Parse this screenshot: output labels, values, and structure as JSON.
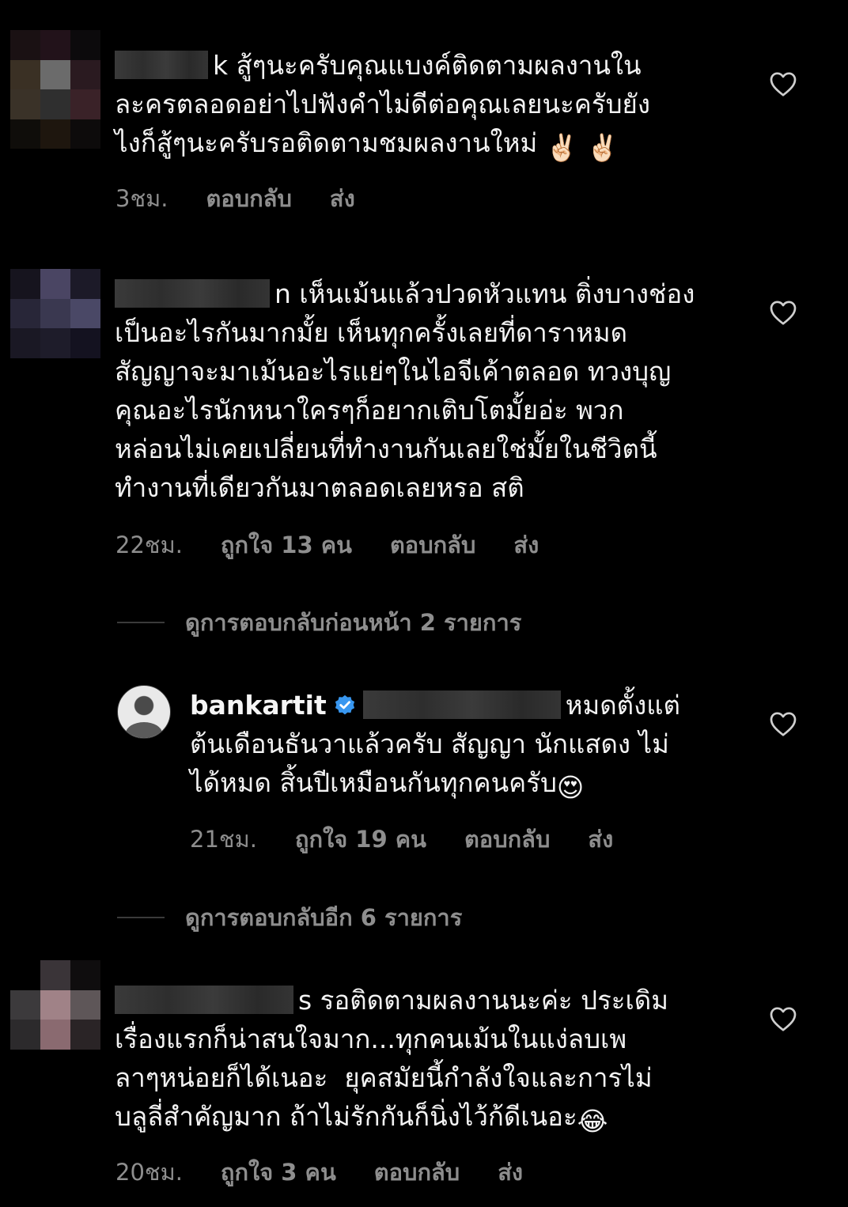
{
  "comments": [
    {
      "text": "สู้ๆนะครับคุณแบงค์ติดตามผลงานในละครตลอดอย่าไปฟังคำไม่ดีต่อคุณเลยนะครับยังไงก็สู้ๆนะครับรอติดตามชมผลงานใหม่",
      "text_prefix": "k",
      "line1": "k สู้ๆนะครับคุณแบงค์ติดตามผลงานใน",
      "line2": "ละครตลอดอย่าไปฟังคำไม่ดีต่อคุณเลยนะครับยัง",
      "line3": "ไงก็สู้ๆนะครับรอติดตามชมผลงานใหม่",
      "emoji": "✌🏻 ✌🏻",
      "time": "3ชม.",
      "reply": "ตอบกลับ",
      "send": "ส่ง"
    },
    {
      "line1": "n เห็นเม้นแล้วปวดหัวแทน ติ่งบางช่อง",
      "line2": "เป็นอะไรกันมากมั้ย เห็นทุกครั้งเลยที่ดาราหมด",
      "line3": "สัญญาจะมาเม้นอะไรแย่ๆในไอจีเค้าตลอด ทวงบุญ",
      "line4": "คุณอะไรนักหนาใครๆก็อยากเติบโตมั้ยอ่ะ พวก",
      "line5": "หล่อนไม่เคยเปลี่ยนที่ทำงานกันเลยใช่มั้ยในชีวิตนี้",
      "line6": "ทำงานที่เดียวกันมาตลอดเลยหรอ สติ",
      "time": "22ชม.",
      "likes": "ถูกใจ 13 คน",
      "reply": "ตอบกลับ",
      "send": "ส่ง"
    }
  ],
  "view_previous_replies": "ดูการตอบกลับก่อนหน้า 2 รายการ",
  "owner_reply": {
    "username": "bankartit",
    "line1_suffix": "หมดตั้งแต่",
    "line2": "ต้นเดือนธันวาแล้วครับ สัญญา นักแสดง ไม่",
    "line3": "ได้หมด สิ้นปีเหมือนกันทุกคนครับ",
    "emoji": "😍",
    "time": "21ชม.",
    "likes": "ถูกใจ 19 คน",
    "reply": "ตอบกลับ",
    "send": "ส่ง"
  },
  "view_more_replies": "ดูการตอบกลับอีก 6 รายการ",
  "last_comment": {
    "line1": "s รอติดตามผลงานนะค่ะ ประเดิม",
    "line2": "เรื่องแรกก็น่าสนใจมาก...ทุกคนเม้นในแง่ลบเพ",
    "line3": "ลาๆหน่อยก็ได้เนอะ  ยุคสมัยนี้กำลังใจและการไม่",
    "line4": "บลูลี่สำคัญมาก ถ้าไม่รักกันก็นิ่งไว้ก้ดีเนอะ",
    "emoji": "😂",
    "time": "20ชม.",
    "likes": "ถูกใจ 3 คน",
    "reply": "ตอบกลับ",
    "send": "ส่ง"
  },
  "colors": {
    "background": "#000000",
    "text": "#f2f2f2",
    "meta": "#8e8e8e",
    "verified": "#3897f0"
  },
  "icons": [
    "heart-outline-icon",
    "verified-badge-icon"
  ]
}
